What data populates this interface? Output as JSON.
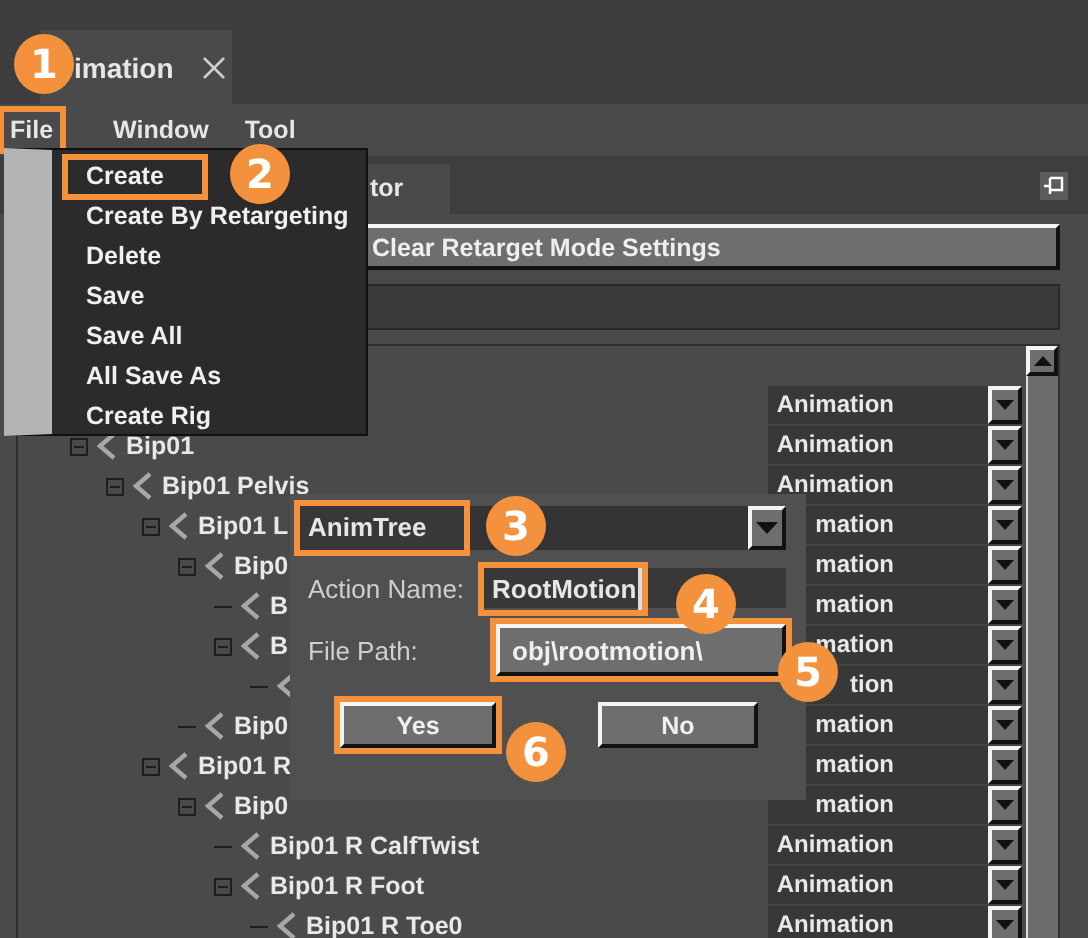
{
  "window_tab": {
    "label": "imation"
  },
  "menu_bar": [
    {
      "label": "File",
      "highlighted": true
    },
    {
      "label": "Window",
      "highlighted": false
    },
    {
      "label": "Tool",
      "highlighted": false
    }
  ],
  "file_menu": [
    {
      "label": "Create",
      "highlighted": true
    },
    {
      "label": "Create By Retargeting",
      "highlighted": false
    },
    {
      "label": "Delete",
      "highlighted": false
    },
    {
      "label": "Save",
      "highlighted": false
    },
    {
      "label": "Save All",
      "highlighted": false
    },
    {
      "label": "All Save As",
      "highlighted": false
    },
    {
      "label": "Create Rig",
      "highlighted": false
    }
  ],
  "panel_tab": {
    "label": "tor"
  },
  "clear_button": {
    "label": "Clear Retarget Mode Settings"
  },
  "tree": [
    {
      "label": "Bip01",
      "expanded": true,
      "children": [
        {
          "label": "Bip01 Pelvis",
          "expanded": true,
          "children": [
            {
              "label": "Bip01 L",
              "expanded": true,
              "children": [
                {
                  "label": "Bip0",
                  "expanded": true,
                  "children": [
                    {
                      "label": "B"
                    },
                    {
                      "label": "B",
                      "expanded": true
                    }
                  ]
                },
                {
                  "label": "Bip0"
                }
              ]
            },
            {
              "label": "Bip01 R",
              "expanded": true,
              "children": [
                {
                  "label": "Bip0",
                  "expanded": true,
                  "children": [
                    {
                      "label": "Bip01 R CalfTwist"
                    },
                    {
                      "label": "Bip01 R Foot",
                      "expanded": true,
                      "children": [
                        {
                          "label": "Bip01 R Toe0"
                        }
                      ]
                    }
                  ]
                }
              ]
            }
          ]
        }
      ]
    }
  ],
  "animation_column": [
    "Animation",
    "Animation",
    "Animation",
    "mation",
    "mation",
    "mation",
    "mation",
    "tion",
    "mation",
    "mation",
    "mation",
    "Animation",
    "Animation",
    "Animation"
  ],
  "dialog": {
    "type_dropdown": {
      "value": "AnimTree",
      "highlighted": true
    },
    "action_name": {
      "label": "Action Name:",
      "value": "RootMotion",
      "highlighted": true
    },
    "file_path": {
      "label": "File Path:",
      "value": "obj\\rootmotion\\",
      "highlighted": true
    },
    "buttons": [
      {
        "label": "Yes",
        "highlighted": true
      },
      {
        "label": "No",
        "highlighted": false
      }
    ]
  },
  "callouts": [
    "1",
    "2",
    "3",
    "4",
    "5",
    "6"
  ]
}
